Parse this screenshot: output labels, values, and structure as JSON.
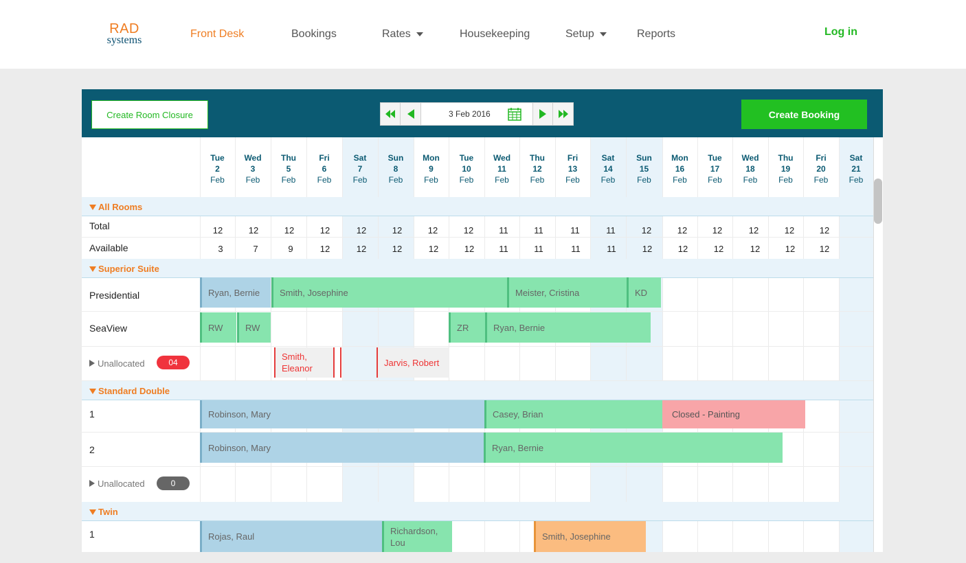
{
  "nav": {
    "logo_top": "RAD",
    "logo_bottom": "systems",
    "items": [
      "Front Desk",
      "Bookings",
      "Rates",
      "Housekeeping",
      "Setup",
      "Reports"
    ],
    "login": "Log in"
  },
  "toolbar": {
    "create_closure": "Create Room Closure",
    "date": "3 Feb 2016",
    "create_booking": "Create Booking"
  },
  "days": [
    {
      "dow": "Tue",
      "num": "2",
      "mon": "Feb"
    },
    {
      "dow": "Wed",
      "num": "3",
      "mon": "Feb"
    },
    {
      "dow": "Thu",
      "num": "5",
      "mon": "Feb"
    },
    {
      "dow": "Fri",
      "num": "6",
      "mon": "Feb"
    },
    {
      "dow": "Sat",
      "num": "7",
      "mon": "Feb"
    },
    {
      "dow": "Sun",
      "num": "8",
      "mon": "Feb"
    },
    {
      "dow": "Mon",
      "num": "9",
      "mon": "Feb"
    },
    {
      "dow": "Tue",
      "num": "10",
      "mon": "Feb"
    },
    {
      "dow": "Wed",
      "num": "11",
      "mon": "Feb"
    },
    {
      "dow": "Thu",
      "num": "12",
      "mon": "Feb"
    },
    {
      "dow": "Fri",
      "num": "13",
      "mon": "Feb"
    },
    {
      "dow": "Sat",
      "num": "14",
      "mon": "Feb"
    },
    {
      "dow": "Sun",
      "num": "15",
      "mon": "Feb"
    },
    {
      "dow": "Mon",
      "num": "16",
      "mon": "Feb"
    },
    {
      "dow": "Tue",
      "num": "17",
      "mon": "Feb"
    },
    {
      "dow": "Wed",
      "num": "18",
      "mon": "Feb"
    },
    {
      "dow": "Thu",
      "num": "19",
      "mon": "Feb"
    },
    {
      "dow": "Fri",
      "num": "20",
      "mon": "Feb"
    },
    {
      "dow": "Sat",
      "num": "21",
      "mon": "Feb"
    }
  ],
  "all_rooms": {
    "label": "All Rooms",
    "total_label": "Total",
    "available_label": "Available",
    "total": [
      "12",
      "12",
      "12",
      "12",
      "12",
      "12",
      "12",
      "12",
      "11",
      "11",
      "11",
      "11",
      "12",
      "12",
      "12",
      "12",
      "12",
      "12"
    ],
    "available": [
      "3",
      "7",
      "9",
      "12",
      "12",
      "12",
      "12",
      "12",
      "11",
      "11",
      "11",
      "11",
      "12",
      "12",
      "12",
      "12",
      "12",
      "12"
    ]
  },
  "groups": {
    "superior_suite": "Superior Suite",
    "standard_double": "Standard Double",
    "twin": "Twin"
  },
  "rooms": {
    "presidential": "Presidential",
    "seaview": "SeaView",
    "unallocated": "Unallocated",
    "sd1": "1",
    "sd2": "2",
    "tw1": "1"
  },
  "badges": {
    "superior_unallocated": "04",
    "standard_unallocated": "0"
  },
  "bookings": {
    "pres_1": "Ryan, Bernie",
    "pres_2": "Smith, Josephine",
    "pres_3": "Meister, Cristina",
    "pres_4": "KD",
    "sea_1": "RW",
    "sea_2": "RW",
    "sea_3": "ZR",
    "sea_4": "Ryan, Bernie",
    "un_1": "Smith, Eleanor",
    "un_2": "Jarvis, Robert",
    "sd1_1": "Robinson, Mary",
    "sd1_2": "Casey, Brian",
    "sd1_3": "Closed - Painting",
    "sd2_1": "Robinson, Mary",
    "sd2_2": "Ryan, Bernie",
    "tw1_1": "Rojas, Raul",
    "tw1_2": "Richardson, Lou",
    "tw1_3": "Smith, Josephine"
  },
  "colors": {
    "accent_orange": "#ef7d22",
    "accent_green": "#22b822",
    "toolbar": "#0b5a72",
    "booking_blue": "#aed3e6",
    "booking_green": "#87e4ae",
    "closure_pink": "#f8a5a8",
    "booking_orange": "#fbbc80",
    "badge_red": "#f0333d",
    "badge_grey": "#666666"
  }
}
